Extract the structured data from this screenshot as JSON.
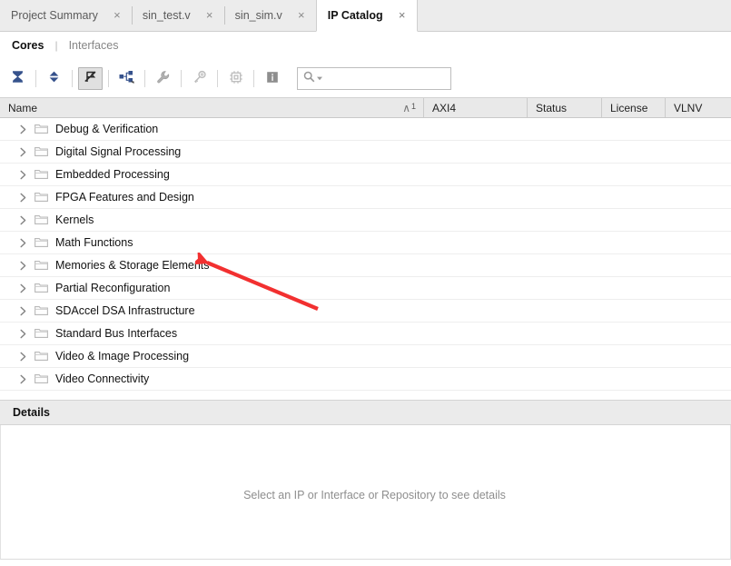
{
  "tabs": {
    "items": [
      {
        "label": "Project Summary",
        "active": false,
        "close_icon": "×"
      },
      {
        "label": "sin_test.v",
        "active": false,
        "close_icon": "×"
      },
      {
        "label": "sin_sim.v",
        "active": false,
        "close_icon": "×"
      },
      {
        "label": "IP Catalog",
        "active": true,
        "close_icon": "×"
      }
    ]
  },
  "subtabs": {
    "cores_label": "Cores",
    "separator": "|",
    "interfaces_label": "Interfaces"
  },
  "toolbar": {
    "buttons": [
      {
        "name": "collapse-all-icon",
        "title": "Collapse All",
        "pressed": false
      },
      {
        "name": "expand-all-icon",
        "title": "Expand All",
        "pressed": false
      },
      {
        "name": "hide-disabled-icon",
        "title": "Hide Disabled",
        "pressed": true
      },
      {
        "name": "group-hierarchy-icon",
        "title": "Group By",
        "pressed": false
      },
      {
        "name": "wrench-icon",
        "title": "IP Settings",
        "pressed": false
      },
      {
        "name": "key-icon",
        "title": "Licenses",
        "pressed": false
      },
      {
        "name": "chip-icon",
        "title": "IP Properties",
        "pressed": false
      },
      {
        "name": "info-icon",
        "title": "Information",
        "pressed": false
      }
    ],
    "search": {
      "value": "",
      "placeholder": "",
      "icon": "search-icon",
      "dropdown_icon": "caret-down-icon"
    }
  },
  "table": {
    "columns": [
      {
        "key": "name",
        "label": "Name"
      },
      {
        "key": "axi4",
        "label": "AXI4"
      },
      {
        "key": "status",
        "label": "Status"
      },
      {
        "key": "license",
        "label": "License"
      },
      {
        "key": "vlnv",
        "label": "VLNV"
      }
    ],
    "sort": {
      "column": "Name",
      "direction": "∧",
      "order": "1"
    },
    "rows": [
      {
        "label": "Debug & Verification",
        "expanded": false
      },
      {
        "label": "Digital Signal Processing",
        "expanded": false
      },
      {
        "label": "Embedded Processing",
        "expanded": false
      },
      {
        "label": "FPGA Features and Design",
        "expanded": false
      },
      {
        "label": "Kernels",
        "expanded": false
      },
      {
        "label": "Math Functions",
        "expanded": false
      },
      {
        "label": "Memories & Storage Elements",
        "expanded": false
      },
      {
        "label": "Partial Reconfiguration",
        "expanded": false
      },
      {
        "label": "SDAccel DSA Infrastructure",
        "expanded": false
      },
      {
        "label": "Standard Bus Interfaces",
        "expanded": false
      },
      {
        "label": "Video & Image Processing",
        "expanded": false
      },
      {
        "label": "Video Connectivity",
        "expanded": false
      }
    ]
  },
  "details": {
    "title": "Details",
    "placeholder": "Select an IP or Interface or Repository to see details"
  },
  "annotation": {
    "type": "arrow",
    "color": "#f23030",
    "points_to": "Memories & Storage Elements"
  },
  "colors": {
    "tab_bar_bg": "#ececec",
    "active_tab_bg": "#ffffff",
    "header_bg": "#e9e9e9",
    "details_header_bg": "#ebebeb",
    "icon_blue": "#36528c",
    "icon_gray": "#b5b5b5",
    "annotation_red": "#f23030"
  }
}
